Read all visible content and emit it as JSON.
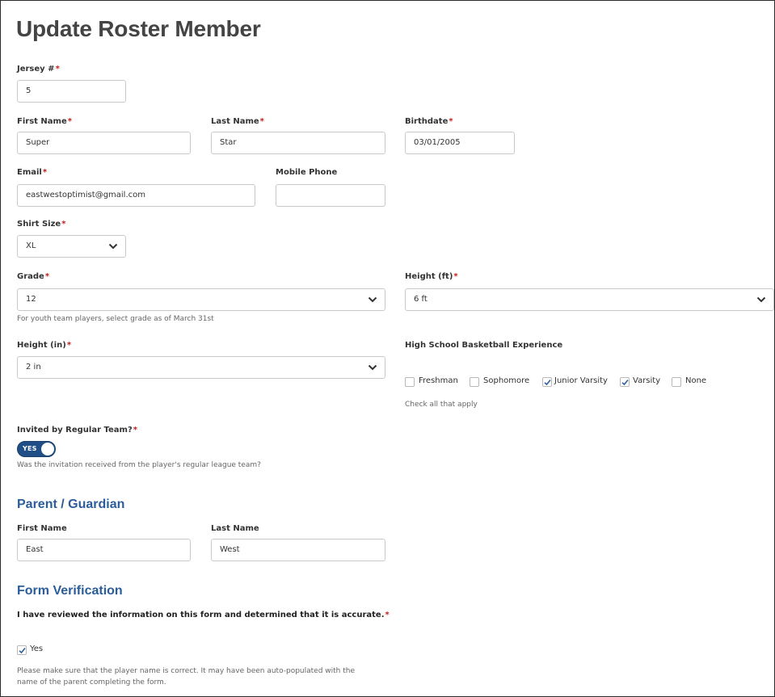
{
  "page": {
    "title": "Update Roster Member"
  },
  "required_mark": "*",
  "jersey": {
    "label": "Jersey #",
    "value": "5"
  },
  "first_name": {
    "label": "First Name",
    "value": "Super"
  },
  "last_name": {
    "label": "Last Name",
    "value": "Star"
  },
  "birthdate": {
    "label": "Birthdate",
    "value": "03/01/2005"
  },
  "email": {
    "label": "Email",
    "value": "eastwestoptimist@gmail.com"
  },
  "mobile_phone": {
    "label": "Mobile Phone",
    "value": ""
  },
  "shirt_size": {
    "label": "Shirt Size",
    "value": "XL"
  },
  "grade": {
    "label": "Grade",
    "value": "12",
    "help": "For youth team players, select grade as of March 31st"
  },
  "height_ft": {
    "label": "Height (ft)",
    "value": "6 ft"
  },
  "height_in": {
    "label": "Height (in)",
    "value": "2 in"
  },
  "experience": {
    "label": "High School Basketball Experience",
    "help": "Check all that apply",
    "options": [
      {
        "label": "Freshman",
        "checked": false
      },
      {
        "label": "Sophomore",
        "checked": false
      },
      {
        "label": "Junior Varsity",
        "checked": true
      },
      {
        "label": "Varsity",
        "checked": true
      },
      {
        "label": "None",
        "checked": false
      }
    ]
  },
  "invited": {
    "label": "Invited by Regular Team?",
    "toggle_label": "YES",
    "toggle_on": true,
    "help": "Was the invitation received from the player's regular league team?"
  },
  "parent": {
    "heading": "Parent / Guardian",
    "first_name_label": "First Name",
    "first_name_value": "East",
    "last_name_label": "Last Name",
    "last_name_value": "West"
  },
  "verification": {
    "heading": "Form Verification",
    "statement": "I have reviewed the information on this form and determined that it is accurate.",
    "checkbox_label": "Yes",
    "checked": true,
    "note_line1": "Please make sure that the player name is correct. It may have been auto-populated with the",
    "note_line2": "name of the parent completing the form."
  },
  "colors": {
    "accent": "#2b5d9a",
    "toggle": "#1f4f86",
    "required": "#c41c1c",
    "check": "#2b5d9a"
  },
  "icons": {
    "select_arrow": "chevron-down-icon",
    "checkmark": "checkmark-icon"
  }
}
